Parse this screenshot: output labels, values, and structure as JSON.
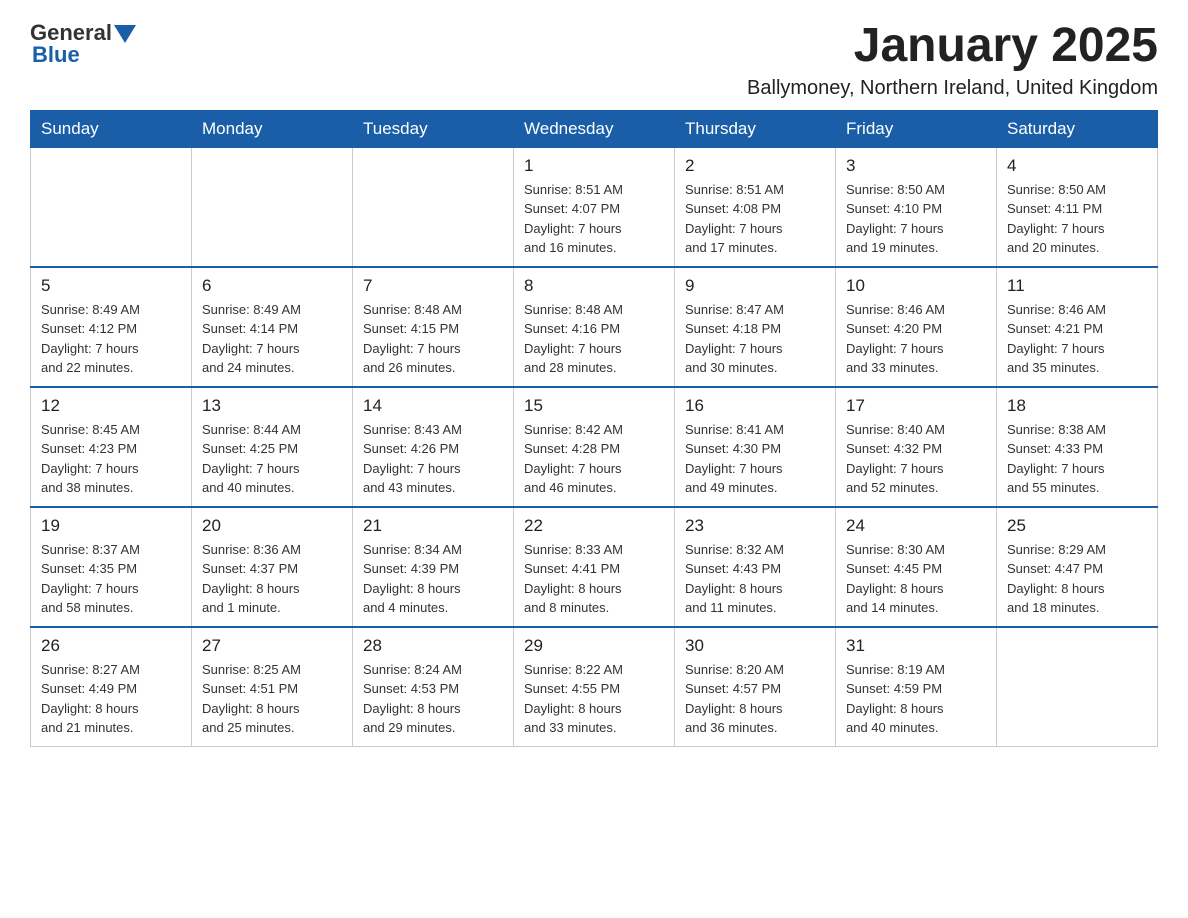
{
  "header": {
    "logo_general": "General",
    "logo_blue": "Blue",
    "title": "January 2025",
    "subtitle": "Ballymoney, Northern Ireland, United Kingdom"
  },
  "days_of_week": [
    "Sunday",
    "Monday",
    "Tuesday",
    "Wednesday",
    "Thursday",
    "Friday",
    "Saturday"
  ],
  "weeks": [
    [
      {
        "day": "",
        "info": ""
      },
      {
        "day": "",
        "info": ""
      },
      {
        "day": "",
        "info": ""
      },
      {
        "day": "1",
        "info": "Sunrise: 8:51 AM\nSunset: 4:07 PM\nDaylight: 7 hours\nand 16 minutes."
      },
      {
        "day": "2",
        "info": "Sunrise: 8:51 AM\nSunset: 4:08 PM\nDaylight: 7 hours\nand 17 minutes."
      },
      {
        "day": "3",
        "info": "Sunrise: 8:50 AM\nSunset: 4:10 PM\nDaylight: 7 hours\nand 19 minutes."
      },
      {
        "day": "4",
        "info": "Sunrise: 8:50 AM\nSunset: 4:11 PM\nDaylight: 7 hours\nand 20 minutes."
      }
    ],
    [
      {
        "day": "5",
        "info": "Sunrise: 8:49 AM\nSunset: 4:12 PM\nDaylight: 7 hours\nand 22 minutes."
      },
      {
        "day": "6",
        "info": "Sunrise: 8:49 AM\nSunset: 4:14 PM\nDaylight: 7 hours\nand 24 minutes."
      },
      {
        "day": "7",
        "info": "Sunrise: 8:48 AM\nSunset: 4:15 PM\nDaylight: 7 hours\nand 26 minutes."
      },
      {
        "day": "8",
        "info": "Sunrise: 8:48 AM\nSunset: 4:16 PM\nDaylight: 7 hours\nand 28 minutes."
      },
      {
        "day": "9",
        "info": "Sunrise: 8:47 AM\nSunset: 4:18 PM\nDaylight: 7 hours\nand 30 minutes."
      },
      {
        "day": "10",
        "info": "Sunrise: 8:46 AM\nSunset: 4:20 PM\nDaylight: 7 hours\nand 33 minutes."
      },
      {
        "day": "11",
        "info": "Sunrise: 8:46 AM\nSunset: 4:21 PM\nDaylight: 7 hours\nand 35 minutes."
      }
    ],
    [
      {
        "day": "12",
        "info": "Sunrise: 8:45 AM\nSunset: 4:23 PM\nDaylight: 7 hours\nand 38 minutes."
      },
      {
        "day": "13",
        "info": "Sunrise: 8:44 AM\nSunset: 4:25 PM\nDaylight: 7 hours\nand 40 minutes."
      },
      {
        "day": "14",
        "info": "Sunrise: 8:43 AM\nSunset: 4:26 PM\nDaylight: 7 hours\nand 43 minutes."
      },
      {
        "day": "15",
        "info": "Sunrise: 8:42 AM\nSunset: 4:28 PM\nDaylight: 7 hours\nand 46 minutes."
      },
      {
        "day": "16",
        "info": "Sunrise: 8:41 AM\nSunset: 4:30 PM\nDaylight: 7 hours\nand 49 minutes."
      },
      {
        "day": "17",
        "info": "Sunrise: 8:40 AM\nSunset: 4:32 PM\nDaylight: 7 hours\nand 52 minutes."
      },
      {
        "day": "18",
        "info": "Sunrise: 8:38 AM\nSunset: 4:33 PM\nDaylight: 7 hours\nand 55 minutes."
      }
    ],
    [
      {
        "day": "19",
        "info": "Sunrise: 8:37 AM\nSunset: 4:35 PM\nDaylight: 7 hours\nand 58 minutes."
      },
      {
        "day": "20",
        "info": "Sunrise: 8:36 AM\nSunset: 4:37 PM\nDaylight: 8 hours\nand 1 minute."
      },
      {
        "day": "21",
        "info": "Sunrise: 8:34 AM\nSunset: 4:39 PM\nDaylight: 8 hours\nand 4 minutes."
      },
      {
        "day": "22",
        "info": "Sunrise: 8:33 AM\nSunset: 4:41 PM\nDaylight: 8 hours\nand 8 minutes."
      },
      {
        "day": "23",
        "info": "Sunrise: 8:32 AM\nSunset: 4:43 PM\nDaylight: 8 hours\nand 11 minutes."
      },
      {
        "day": "24",
        "info": "Sunrise: 8:30 AM\nSunset: 4:45 PM\nDaylight: 8 hours\nand 14 minutes."
      },
      {
        "day": "25",
        "info": "Sunrise: 8:29 AM\nSunset: 4:47 PM\nDaylight: 8 hours\nand 18 minutes."
      }
    ],
    [
      {
        "day": "26",
        "info": "Sunrise: 8:27 AM\nSunset: 4:49 PM\nDaylight: 8 hours\nand 21 minutes."
      },
      {
        "day": "27",
        "info": "Sunrise: 8:25 AM\nSunset: 4:51 PM\nDaylight: 8 hours\nand 25 minutes."
      },
      {
        "day": "28",
        "info": "Sunrise: 8:24 AM\nSunset: 4:53 PM\nDaylight: 8 hours\nand 29 minutes."
      },
      {
        "day": "29",
        "info": "Sunrise: 8:22 AM\nSunset: 4:55 PM\nDaylight: 8 hours\nand 33 minutes."
      },
      {
        "day": "30",
        "info": "Sunrise: 8:20 AM\nSunset: 4:57 PM\nDaylight: 8 hours\nand 36 minutes."
      },
      {
        "day": "31",
        "info": "Sunrise: 8:19 AM\nSunset: 4:59 PM\nDaylight: 8 hours\nand 40 minutes."
      },
      {
        "day": "",
        "info": ""
      }
    ]
  ]
}
